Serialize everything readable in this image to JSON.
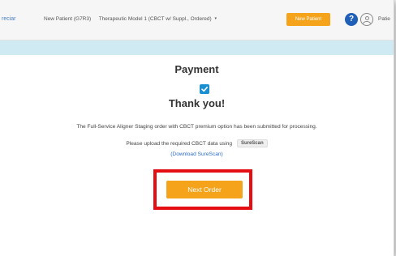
{
  "header": {
    "brand_truncated": "reciar",
    "patient_label": "New Patient (G7R3)",
    "treatment_label": "Therapeutic Model 1 (CBCT w/ Suppl., Ordered)",
    "treatment_caret": "▾",
    "new_patient_button": "New Patient",
    "help_icon": "?",
    "patient_truncated": "Patie"
  },
  "main": {
    "title": "Payment",
    "thanks": "Thank you!",
    "message": "The Full-Service Aligner Staging order with CBCT premium option has been submitted for processing.",
    "upload_text": "Please upload the required CBCT data using",
    "surescan_badge": "SureScan",
    "download_link": "(Download SureScan)",
    "next_order_button": "Next Order"
  },
  "colors": {
    "accent_orange": "#f5a31a",
    "band_blue": "#cfeaf3",
    "check_blue": "#1a8fd1",
    "highlight_red": "#e30d12",
    "link_blue": "#2b6cc4"
  },
  "icons": {
    "help": "help-icon",
    "user": "user-icon",
    "check": "checkbox-check-icon"
  }
}
